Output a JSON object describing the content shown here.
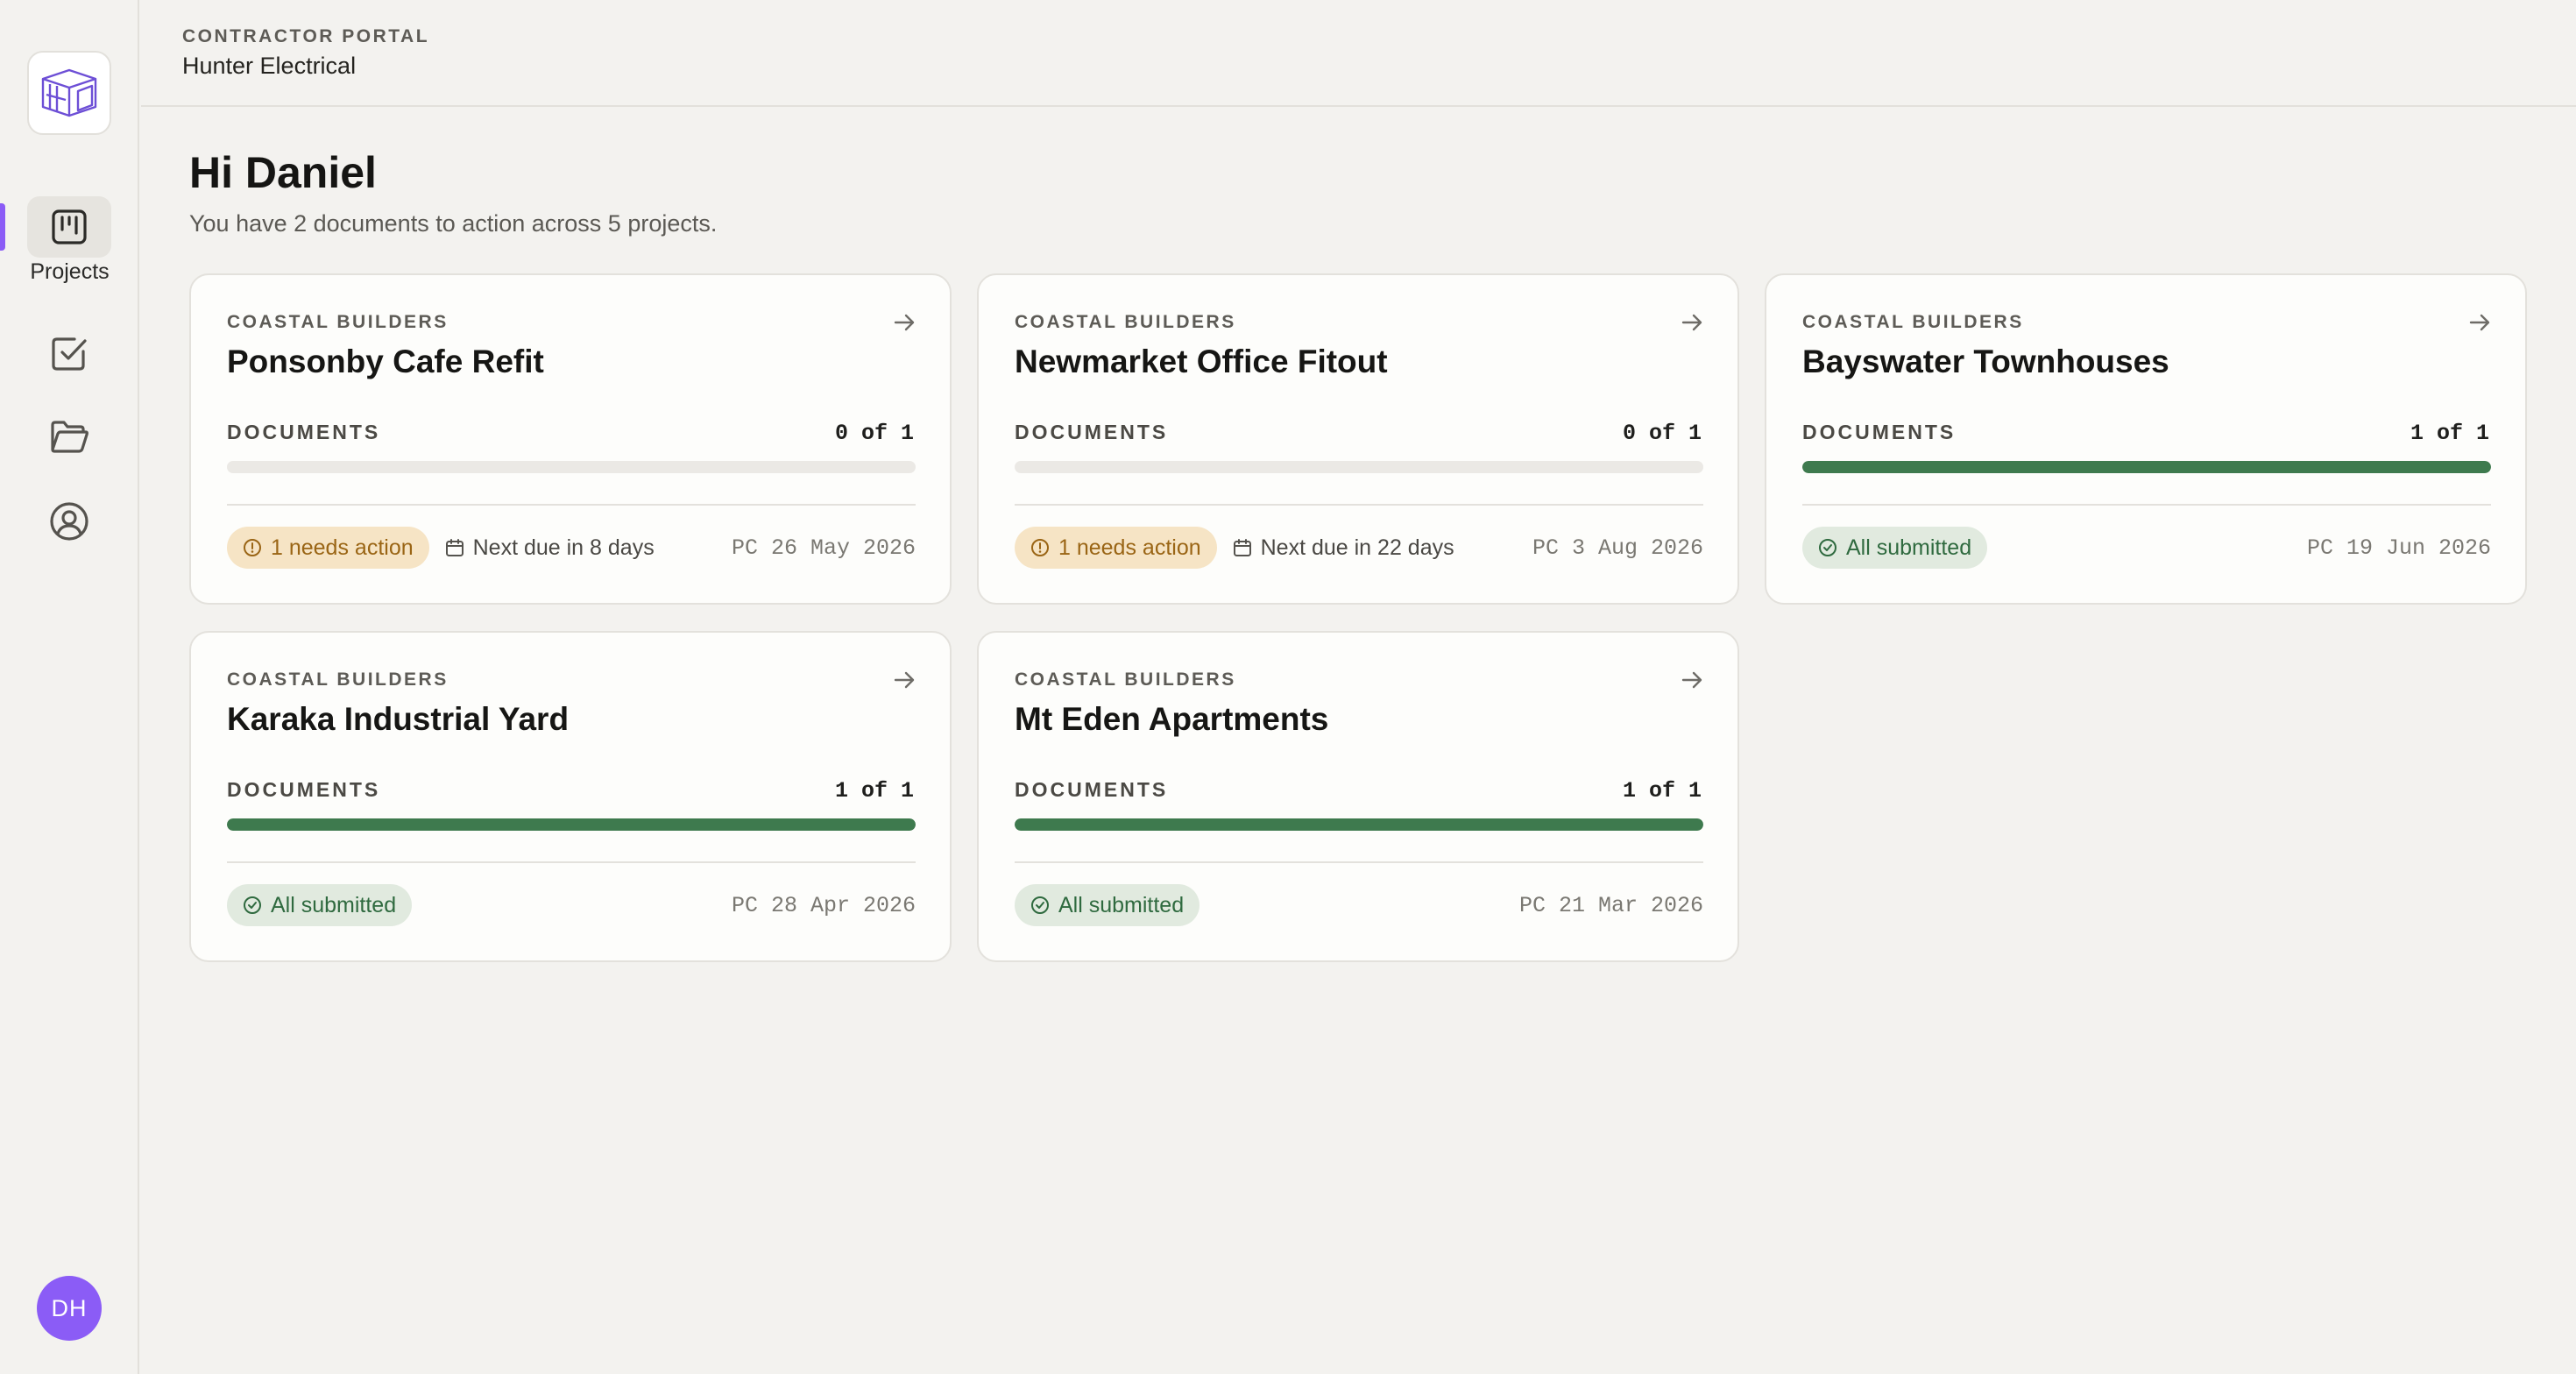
{
  "sidebar": {
    "nav": [
      {
        "id": "projects",
        "label": "Projects",
        "icon": "kanban-board-icon",
        "active": true
      },
      {
        "id": "tasks",
        "icon": "checkbox-icon"
      },
      {
        "id": "files",
        "icon": "folder-open-icon"
      },
      {
        "id": "account",
        "icon": "user-circle-icon"
      }
    ],
    "avatar_initials": "DH"
  },
  "header": {
    "portal_label": "CONTRACTOR PORTAL",
    "company": "Hunter Electrical"
  },
  "main": {
    "greeting": "Hi Daniel",
    "summary": "You have 2 documents to action across 5 projects."
  },
  "projects": [
    {
      "builder": "COASTAL BUILDERS",
      "title": "Ponsonby Cafe Refit",
      "documents_label": "DOCUMENTS",
      "documents_count": "0 of 1",
      "progress": 0,
      "status": "warn",
      "status_label": "1 needs action",
      "due": "Next due in 8 days",
      "pc": "PC 26 May 2026"
    },
    {
      "builder": "COASTAL BUILDERS",
      "title": "Newmarket Office Fitout",
      "documents_label": "DOCUMENTS",
      "documents_count": "0 of 1",
      "progress": 0,
      "status": "warn",
      "status_label": "1 needs action",
      "due": "Next due in 22 days",
      "pc": "PC 3 Aug 2026"
    },
    {
      "builder": "COASTAL BUILDERS",
      "title": "Bayswater Townhouses",
      "documents_label": "DOCUMENTS",
      "documents_count": "1 of 1",
      "progress": 1,
      "status": "ok",
      "status_label": "All submitted",
      "due": "",
      "pc": "PC 19 Jun 2026"
    },
    {
      "builder": "COASTAL BUILDERS",
      "title": "Karaka Industrial Yard",
      "documents_label": "DOCUMENTS",
      "documents_count": "1 of 1",
      "progress": 1,
      "status": "ok",
      "status_label": "All submitted",
      "due": "",
      "pc": "PC 28 Apr 2026"
    },
    {
      "builder": "COASTAL BUILDERS",
      "title": "Mt Eden Apartments",
      "documents_label": "DOCUMENTS",
      "documents_count": "1 of 1",
      "progress": 1,
      "status": "ok",
      "status_label": "All submitted",
      "due": "",
      "pc": "PC 21 Mar 2026"
    }
  ],
  "colors": {
    "accent": "#8b5cf6",
    "progress_fill": "#3e7a4e",
    "warn_bg": "#f6e4c5",
    "warn_text": "#9a6515",
    "ok_bg": "#e1eadf",
    "ok_text": "#2f6a3f"
  }
}
